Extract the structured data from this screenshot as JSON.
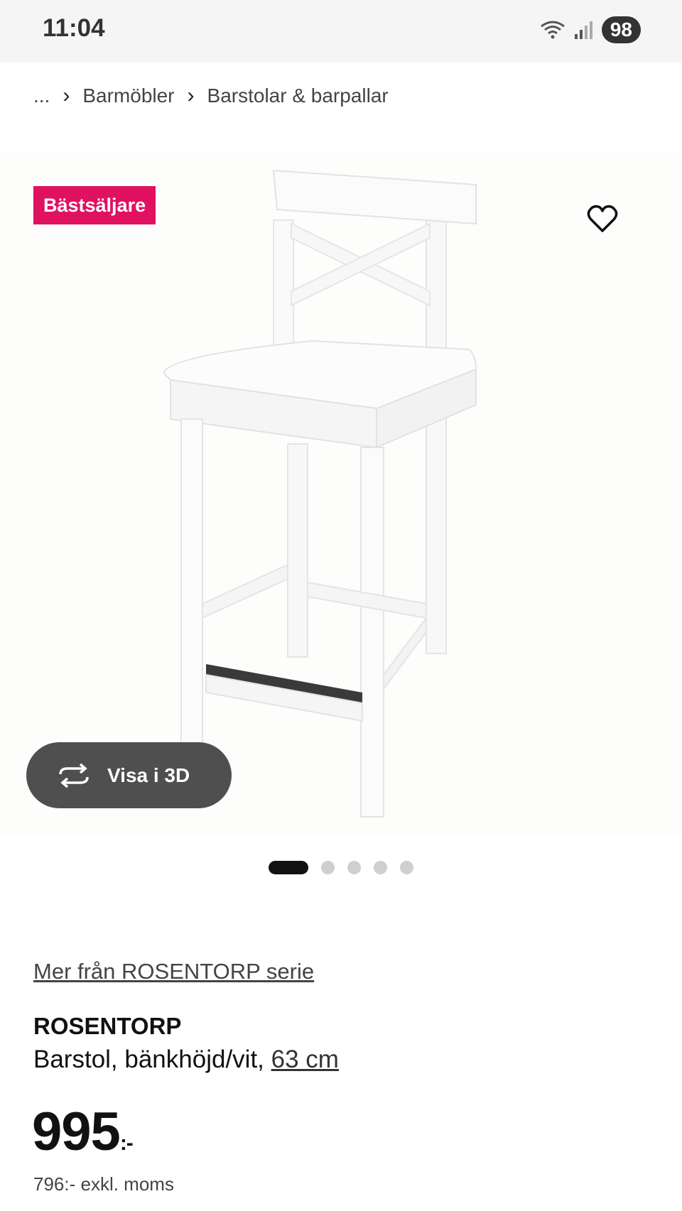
{
  "status_bar": {
    "time": "11:04",
    "battery": "98",
    "icons": [
      "wifi-icon",
      "signal-icon",
      "battery-icon"
    ]
  },
  "breadcrumb": {
    "ellipsis": "...",
    "items": [
      "Barmöbler",
      "Barstolar & barpallar"
    ]
  },
  "badge": {
    "label": "Bästsäljare",
    "color": "#e0115f"
  },
  "gallery": {
    "view_3d_label": "Visa i 3D",
    "image_count": 5,
    "active_index": 0
  },
  "product": {
    "series_link": "Mer från ROSENTORP serie",
    "name": "ROSENTORP",
    "description": "Barstol, bänkhöjd/vit, ",
    "size": "63 cm",
    "price": "995",
    "price_suffix": ":-",
    "price_ex_vat": "796:- exkl. moms"
  }
}
